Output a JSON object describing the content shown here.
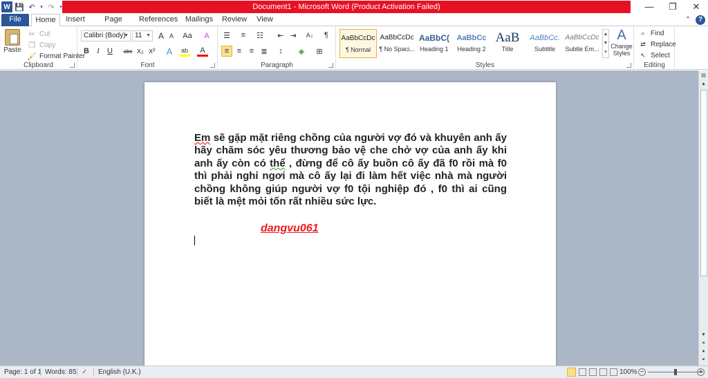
{
  "window": {
    "title": "Document1  -  Microsoft Word (Product Activation Failed)",
    "controls": {
      "minimize": "—",
      "restore": "❐",
      "close": "✕"
    }
  },
  "qat": {
    "word_logo": "W",
    "save": "💾",
    "undo": "↶",
    "redo": "↷",
    "customize": "▾"
  },
  "tabs": [
    {
      "label": "File"
    },
    {
      "label": "Home"
    },
    {
      "label": "Insert"
    },
    {
      "label": "Page Layout"
    },
    {
      "label": "References"
    },
    {
      "label": "Mailings"
    },
    {
      "label": "Review"
    },
    {
      "label": "View"
    }
  ],
  "ribbon": {
    "clipboard": {
      "label": "Clipboard",
      "paste": "Paste",
      "cut": "Cut",
      "copy": "Copy",
      "format_painter": "Format Painter"
    },
    "font": {
      "label": "Font",
      "font_name": "Calibri (Body)",
      "font_size": "11",
      "grow": "A",
      "shrink": "A",
      "case": "Aa",
      "clear": "A",
      "bold": "B",
      "italic": "I",
      "underline": "U",
      "strike": "abc",
      "sub": "x₂",
      "sup": "x²",
      "effects": "A",
      "highlight": "ab",
      "color": "A"
    },
    "paragraph": {
      "label": "Paragraph",
      "show_marks": "¶",
      "sort": "A↓"
    },
    "styles": {
      "label": "Styles",
      "change_styles": "Change Styles",
      "items": [
        {
          "preview": "AaBbCcDc",
          "name": "¶ Normal"
        },
        {
          "preview": "AaBbCcDc",
          "name": "¶ No Spaci..."
        },
        {
          "preview": "AaBbC(",
          "name": "Heading 1"
        },
        {
          "preview": "AaBbCc",
          "name": "Heading 2"
        },
        {
          "preview": "AaB",
          "name": "Title"
        },
        {
          "preview": "AaBbCc.",
          "name": "Subtitle"
        },
        {
          "preview": "AaBbCcDc",
          "name": "Subtle Em..."
        }
      ]
    },
    "editing": {
      "label": "Editing",
      "find": "Find",
      "replace": "Replace",
      "select": "Select"
    }
  },
  "document": {
    "p1_word1": "Em",
    "p1_rest_a": " sẽ gặp mặt riêng chồng của người vợ đó và khuyên anh ấy hãy chăm sóc yêu thương bảo vệ che chở vợ của anh ấy khi anh ấy còn có ",
    "p1_the": "thể",
    "p1_rest_b": " , đừng để cô ấy buồn cô ấy đã f0 rồi mà f0 thì phải nghỉ ngơi mà cô ấy lại  đi làm hết việc nhà mà người chồng không giúp người vợ f0 tội nghiệp đó , f0 thì ai cũng biết là mệt mỏi tốn rất nhiều sức lực.",
    "signature": "dangvu061"
  },
  "status": {
    "page": "Page: 1 of 1",
    "words": "Words: 85",
    "language": "English (U.K.)",
    "zoom": "100%",
    "zoom_level": 0.5
  }
}
